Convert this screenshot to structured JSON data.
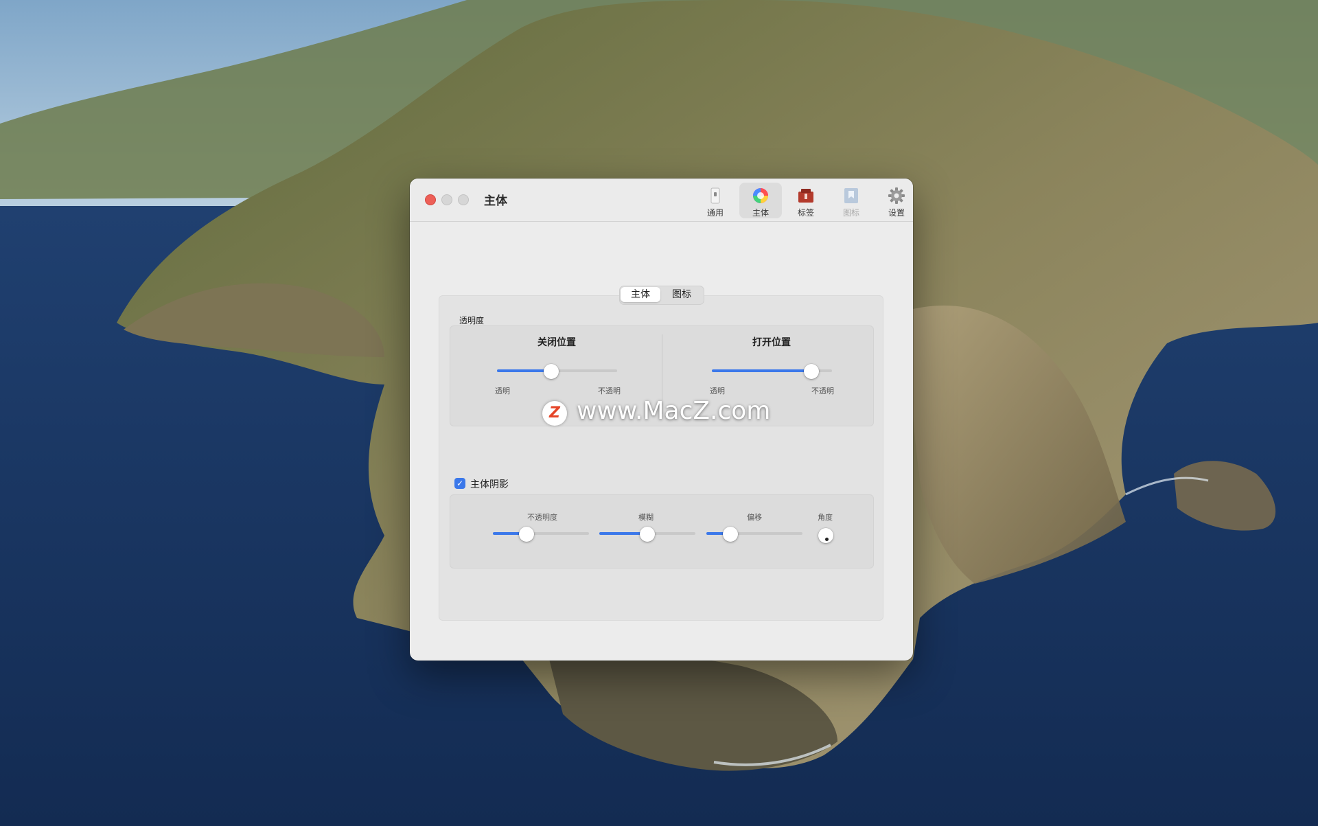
{
  "window": {
    "title": "主体"
  },
  "toolbar": {
    "items": [
      {
        "label": "通用",
        "icon": "phone-icon",
        "active": false,
        "disabled": false
      },
      {
        "label": "主体",
        "icon": "color-wheel-icon",
        "active": true,
        "disabled": false
      },
      {
        "label": "标签",
        "icon": "tag-box-icon",
        "active": false,
        "disabled": false
      },
      {
        "label": "图标",
        "icon": "bookmark-icon",
        "active": false,
        "disabled": true
      },
      {
        "label": "设置",
        "icon": "gear-icon",
        "active": false,
        "disabled": false
      }
    ]
  },
  "segmented": {
    "selected": "主体",
    "other": "图标"
  },
  "transparency": {
    "section_label": "透明度",
    "closed": {
      "title": "关闭位置",
      "min_label": "透明",
      "max_label": "不透明",
      "value": 0.45
    },
    "open": {
      "title": "打开位置",
      "min_label": "透明",
      "max_label": "不透明",
      "value": 0.83
    }
  },
  "shadow": {
    "checkbox_label": "主体阴影",
    "checked": true,
    "sliders": [
      {
        "label": "不透明度",
        "value": 0.35
      },
      {
        "label": "模糊",
        "value": 0.5
      },
      {
        "label": "偏移",
        "value": 0.25
      }
    ],
    "angle_label": "角度"
  },
  "watermark": {
    "text": "www.MacZ.com",
    "logo_letter": "Z"
  },
  "colors": {
    "accent": "#3b78ea",
    "close": "#ed5f57"
  }
}
